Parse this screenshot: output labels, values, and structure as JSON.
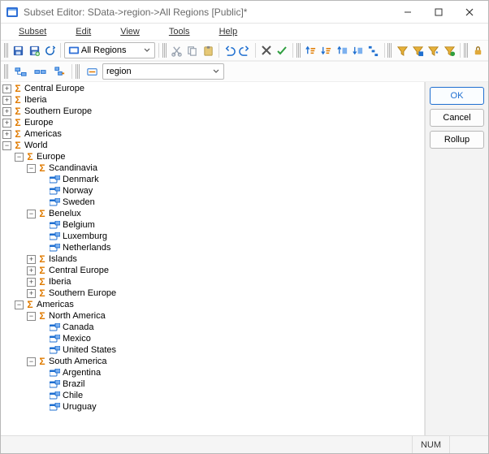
{
  "window": {
    "title": "Subset Editor:  SData->region->All Regions  [Public]*"
  },
  "menu": {
    "subset": "Subset",
    "edit": "Edit",
    "view": "View",
    "tools": "Tools",
    "help": "Help"
  },
  "toolbar1": {
    "subset_combo": "All Regions"
  },
  "toolbar2": {
    "dimension_combo": "region"
  },
  "buttons": {
    "ok": "OK",
    "cancel": "Cancel",
    "rollup": "Rollup"
  },
  "statusbar": {
    "num": "NUM"
  },
  "tree": [
    {
      "d": 0,
      "exp": "plus",
      "kind": "cons",
      "label": "Central Europe"
    },
    {
      "d": 0,
      "exp": "plus",
      "kind": "cons",
      "label": "Iberia"
    },
    {
      "d": 0,
      "exp": "plus",
      "kind": "cons",
      "label": "Southern Europe"
    },
    {
      "d": 0,
      "exp": "plus",
      "kind": "cons",
      "label": "Europe"
    },
    {
      "d": 0,
      "exp": "plus",
      "kind": "cons",
      "label": "Americas"
    },
    {
      "d": 0,
      "exp": "minus",
      "kind": "cons",
      "label": "World"
    },
    {
      "d": 1,
      "exp": "minus",
      "kind": "cons",
      "label": "Europe"
    },
    {
      "d": 2,
      "exp": "minus",
      "kind": "cons",
      "label": "Scandinavia"
    },
    {
      "d": 3,
      "exp": "none",
      "kind": "leaf",
      "label": "Denmark"
    },
    {
      "d": 3,
      "exp": "none",
      "kind": "leaf",
      "label": "Norway"
    },
    {
      "d": 3,
      "exp": "none",
      "kind": "leaf",
      "label": "Sweden"
    },
    {
      "d": 2,
      "exp": "minus",
      "kind": "cons",
      "label": "Benelux"
    },
    {
      "d": 3,
      "exp": "none",
      "kind": "leaf",
      "label": "Belgium"
    },
    {
      "d": 3,
      "exp": "none",
      "kind": "leaf",
      "label": "Luxemburg"
    },
    {
      "d": 3,
      "exp": "none",
      "kind": "leaf",
      "label": "Netherlands"
    },
    {
      "d": 2,
      "exp": "plus",
      "kind": "cons",
      "label": "Islands"
    },
    {
      "d": 2,
      "exp": "plus",
      "kind": "cons",
      "label": "Central Europe"
    },
    {
      "d": 2,
      "exp": "plus",
      "kind": "cons",
      "label": "Iberia"
    },
    {
      "d": 2,
      "exp": "plus",
      "kind": "cons",
      "label": "Southern Europe"
    },
    {
      "d": 1,
      "exp": "minus",
      "kind": "cons",
      "label": "Americas"
    },
    {
      "d": 2,
      "exp": "minus",
      "kind": "cons",
      "label": "North America"
    },
    {
      "d": 3,
      "exp": "none",
      "kind": "leaf",
      "label": "Canada"
    },
    {
      "d": 3,
      "exp": "none",
      "kind": "leaf",
      "label": "Mexico"
    },
    {
      "d": 3,
      "exp": "none",
      "kind": "leaf",
      "label": "United States"
    },
    {
      "d": 2,
      "exp": "minus",
      "kind": "cons",
      "label": "South America"
    },
    {
      "d": 3,
      "exp": "none",
      "kind": "leaf",
      "label": "Argentina"
    },
    {
      "d": 3,
      "exp": "none",
      "kind": "leaf",
      "label": "Brazil"
    },
    {
      "d": 3,
      "exp": "none",
      "kind": "leaf",
      "label": "Chile"
    },
    {
      "d": 3,
      "exp": "none",
      "kind": "leaf",
      "label": "Uruguay"
    }
  ]
}
